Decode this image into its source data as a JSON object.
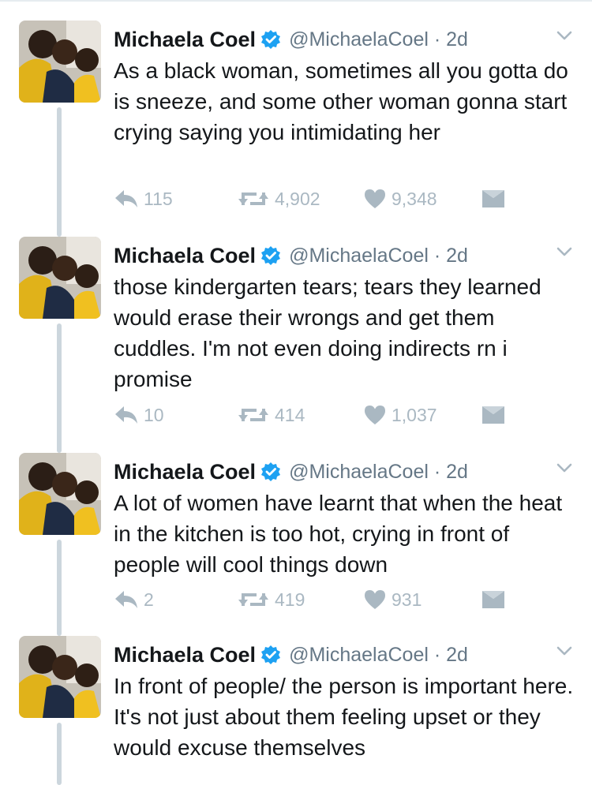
{
  "tweets": [
    {
      "name": "Michaela Coel",
      "handle": "@MichaelaCoel · 2d",
      "text": "As a black woman, sometimes all you gotta do is sneeze, and some other woman gonna start crying saying you intimidating her",
      "replies": "115",
      "retweets": "4,902",
      "likes": "9,348"
    },
    {
      "name": "Michaela Coel",
      "handle": "@MichaelaCoel · 2d",
      "text": "those kindergarten tears; tears they learned would erase their wrongs and get them cuddles. I'm not even doing indirects rn i promise",
      "replies": "10",
      "retweets": "414",
      "likes": "1,037"
    },
    {
      "name": "Michaela Coel",
      "handle": "@MichaelaCoel · 2d",
      "text": "A lot of women have learnt that when the heat in the kitchen is too hot, crying in front of people will cool things down",
      "replies": "2",
      "retweets": "419",
      "likes": "931"
    },
    {
      "name": "Michaela Coel",
      "handle": "@MichaelaCoel · 2d",
      "text": "In front of people/ the person is important here. It's not just about them feeling upset or they would excuse themselves"
    }
  ],
  "icons": {
    "verified": "verified-badge-icon",
    "more": "chevron-down-icon",
    "reply": "reply-arrow-icon",
    "retweet": "retweet-icon",
    "like": "heart-icon",
    "dm": "envelope-icon"
  },
  "colors": {
    "verified": "#1da1f2",
    "text": "#14171a",
    "muted": "#657786",
    "action": "#aab8c2",
    "thread": "#ccd6dd"
  }
}
